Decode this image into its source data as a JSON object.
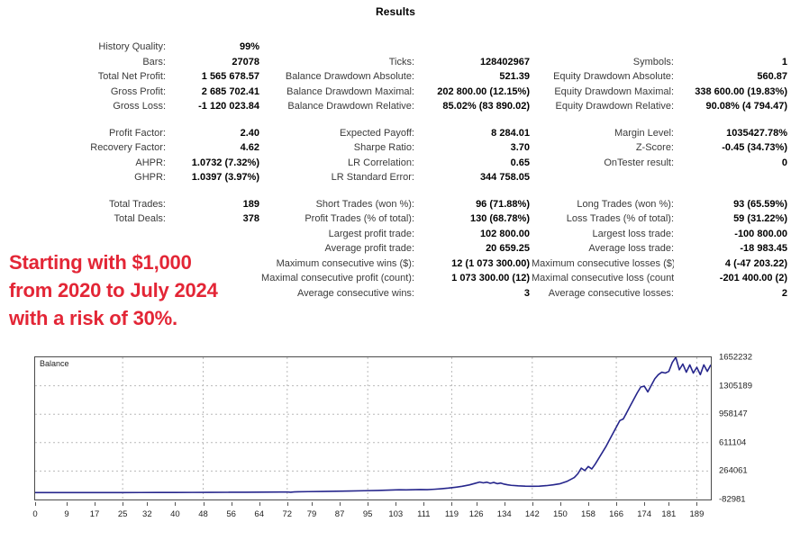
{
  "title": "Results",
  "stats": {
    "block1": [
      [
        {
          "label": "History Quality:",
          "value": "99%"
        },
        {
          "label": "",
          "value": ""
        },
        {
          "label": "",
          "value": ""
        }
      ],
      [
        {
          "label": "Bars:",
          "value": "27078"
        },
        {
          "label": "Ticks:",
          "value": "128402967"
        },
        {
          "label": "Symbols:",
          "value": "1"
        }
      ],
      [
        {
          "label": "Total Net Profit:",
          "value": "1 565 678.57"
        },
        {
          "label": "Balance Drawdown Absolute:",
          "value": "521.39"
        },
        {
          "label": "Equity Drawdown Absolute:",
          "value": "560.87"
        }
      ],
      [
        {
          "label": "Gross Profit:",
          "value": "2 685 702.41"
        },
        {
          "label": "Balance Drawdown Maximal:",
          "value": "202 800.00 (12.15%)"
        },
        {
          "label": "Equity Drawdown Maximal:",
          "value": "338 600.00 (19.83%)"
        }
      ],
      [
        {
          "label": "Gross Loss:",
          "value": "-1 120 023.84"
        },
        {
          "label": "Balance Drawdown Relative:",
          "value": "85.02% (83 890.02)"
        },
        {
          "label": "Equity Drawdown Relative:",
          "value": "90.08% (4 794.47)"
        }
      ]
    ],
    "block2": [
      [
        {
          "label": "Profit Factor:",
          "value": "2.40"
        },
        {
          "label": "Expected Payoff:",
          "value": "8 284.01"
        },
        {
          "label": "Margin Level:",
          "value": "1035427.78%"
        }
      ],
      [
        {
          "label": "Recovery Factor:",
          "value": "4.62"
        },
        {
          "label": "Sharpe Ratio:",
          "value": "3.70"
        },
        {
          "label": "Z-Score:",
          "value": "-0.45 (34.73%)"
        }
      ],
      [
        {
          "label": "AHPR:",
          "value": "1.0732 (7.32%)"
        },
        {
          "label": "LR Correlation:",
          "value": "0.65"
        },
        {
          "label": "OnTester result:",
          "value": "0"
        }
      ],
      [
        {
          "label": "GHPR:",
          "value": "1.0397 (3.97%)"
        },
        {
          "label": "LR Standard Error:",
          "value": "344 758.05"
        },
        {
          "label": "",
          "value": ""
        }
      ]
    ],
    "block3": [
      [
        {
          "label": "Total Trades:",
          "value": "189"
        },
        {
          "label": "Short Trades (won %):",
          "value": "96 (71.88%)"
        },
        {
          "label": "Long Trades (won %):",
          "value": "93 (65.59%)"
        }
      ],
      [
        {
          "label": "Total Deals:",
          "value": "378"
        },
        {
          "label": "Profit Trades (% of total):",
          "value": "130 (68.78%)"
        },
        {
          "label": "Loss Trades (% of total):",
          "value": "59 (31.22%)"
        }
      ],
      [
        {
          "label": "",
          "value": ""
        },
        {
          "label": "Largest profit trade:",
          "value": "102 800.00"
        },
        {
          "label": "Largest loss trade:",
          "value": "-100 800.00"
        }
      ],
      [
        {
          "label": "",
          "value": ""
        },
        {
          "label": "Average profit trade:",
          "value": "20 659.25"
        },
        {
          "label": "Average loss trade:",
          "value": "-18 983.45"
        }
      ],
      [
        {
          "label": "",
          "value": ""
        },
        {
          "label": "Maximum consecutive wins ($):",
          "value": "12 (1 073 300.00)"
        },
        {
          "label": "Maximum consecutive losses ($):",
          "value": "4 (-47 203.22)"
        }
      ],
      [
        {
          "label": "",
          "value": ""
        },
        {
          "label": "Maximal consecutive profit (count):",
          "value": "1 073 300.00 (12)"
        },
        {
          "label": "Maximal consecutive loss (count):",
          "value": "-201 400.00 (2)"
        }
      ],
      [
        {
          "label": "",
          "value": ""
        },
        {
          "label": "Average consecutive wins:",
          "value": "3"
        },
        {
          "label": "Average consecutive losses:",
          "value": "2"
        }
      ]
    ]
  },
  "annotation": {
    "color": "#e32636",
    "lines": [
      "Starting with $1,000",
      "from 2020 to July 2024",
      "with a risk of 30%."
    ]
  },
  "chart_data": {
    "type": "line",
    "title": "",
    "legend": [
      "Balance"
    ],
    "legend_position": "top-left",
    "series_color": "#26268c",
    "xlabel": "",
    "ylabel": "",
    "grid": true,
    "xlim": [
      0,
      193
    ],
    "ylim": [
      -82981,
      1652232
    ],
    "xticks": [
      0,
      9,
      17,
      25,
      32,
      40,
      48,
      56,
      64,
      72,
      79,
      87,
      95,
      103,
      111,
      119,
      126,
      134,
      142,
      150,
      158,
      166,
      174,
      181,
      189
    ],
    "yticks": [
      1652232,
      1305189,
      958147,
      611104,
      264061,
      -82981
    ],
    "series": [
      {
        "name": "Balance",
        "x": [
          0,
          5,
          10,
          15,
          20,
          25,
          30,
          35,
          40,
          45,
          50,
          55,
          60,
          65,
          70,
          72,
          73,
          74,
          75,
          78,
          82,
          86,
          90,
          94,
          98,
          102,
          104,
          106,
          110,
          112,
          114,
          116,
          118,
          120,
          122,
          124,
          126,
          127,
          128,
          129,
          130,
          131,
          132,
          133,
          134,
          135,
          136,
          138,
          140,
          142,
          144,
          146,
          148,
          150,
          152,
          154,
          155,
          156,
          157,
          158,
          159,
          160,
          161,
          162,
          163,
          164,
          165,
          166,
          167,
          168,
          169,
          170,
          171,
          172,
          173,
          174,
          175,
          176,
          177,
          178,
          179,
          180,
          181,
          182,
          183,
          184,
          185,
          186,
          187,
          188,
          189,
          190,
          191,
          192,
          193
        ],
        "y": [
          1000,
          1100,
          1250,
          1400,
          1600,
          1900,
          2200,
          2600,
          3000,
          3500,
          4200,
          5000,
          6000,
          7200,
          8600,
          9000,
          6000,
          9500,
          11000,
          13000,
          15500,
          18000,
          21000,
          24000,
          28000,
          33000,
          36000,
          34000,
          38000,
          37000,
          42000,
          48000,
          56000,
          66000,
          78000,
          95000,
          118000,
          130000,
          120000,
          128000,
          115000,
          125000,
          110000,
          118000,
          104000,
          96000,
          90000,
          84000,
          80000,
          78000,
          80000,
          86000,
          96000,
          110000,
          140000,
          185000,
          230000,
          300000,
          270000,
          320000,
          290000,
          350000,
          420000,
          490000,
          560000,
          640000,
          720000,
          800000,
          880000,
          900000,
          980000,
          1060000,
          1140000,
          1220000,
          1290000,
          1300000,
          1230000,
          1310000,
          1390000,
          1440000,
          1470000,
          1460000,
          1480000,
          1590000,
          1652232,
          1500000,
          1570000,
          1470000,
          1560000,
          1460000,
          1530000,
          1440000,
          1560000,
          1480000,
          1560000,
          1470000,
          1500000
        ]
      }
    ]
  }
}
